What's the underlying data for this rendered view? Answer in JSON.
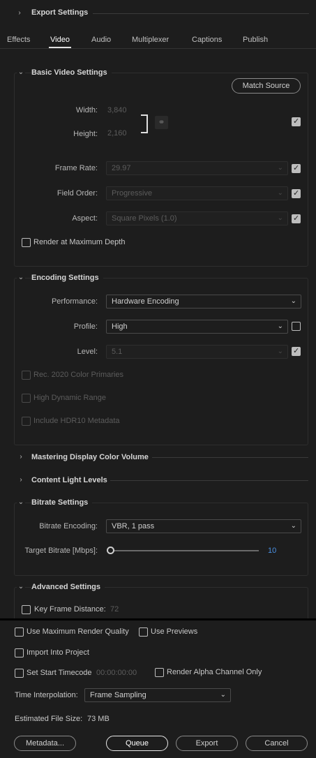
{
  "export_settings": {
    "title": "Export Settings"
  },
  "tabs": [
    {
      "label": "Effects"
    },
    {
      "label": "Video",
      "active": true
    },
    {
      "label": "Audio"
    },
    {
      "label": "Multiplexer"
    },
    {
      "label": "Captions"
    },
    {
      "label": "Publish"
    }
  ],
  "basic_video": {
    "title": "Basic Video Settings",
    "match_source": "Match Source",
    "width_label": "Width:",
    "width_value": "3,840",
    "height_label": "Height:",
    "height_value": "2,160",
    "frame_rate_label": "Frame Rate:",
    "frame_rate_value": "29.97",
    "field_order_label": "Field Order:",
    "field_order_value": "Progressive",
    "aspect_label": "Aspect:",
    "aspect_value": "Square Pixels (1.0)",
    "render_max_depth": "Render at Maximum Depth"
  },
  "encoding": {
    "title": "Encoding Settings",
    "performance_label": "Performance:",
    "performance_value": "Hardware Encoding",
    "profile_label": "Profile:",
    "profile_value": "High",
    "level_label": "Level:",
    "level_value": "5.1",
    "rec2020": "Rec. 2020 Color Primaries",
    "hdr": "High Dynamic Range",
    "hdr10": "Include HDR10 Metadata"
  },
  "mastering": {
    "title": "Mastering Display Color Volume"
  },
  "content_light": {
    "title": "Content Light Levels"
  },
  "bitrate": {
    "title": "Bitrate Settings",
    "encoding_label": "Bitrate Encoding:",
    "encoding_value": "VBR, 1 pass",
    "target_label": "Target Bitrate [Mbps]:",
    "target_value": "10",
    "target_fraction": 0
  },
  "advanced": {
    "title": "Advanced Settings",
    "key_frame_label": "Key Frame Distance:",
    "key_frame_value": "72"
  },
  "bottom": {
    "max_render_quality": "Use Maximum Render Quality",
    "use_previews": "Use Previews",
    "import_into_project": "Import Into Project",
    "set_start_timecode": "Set Start Timecode",
    "timecode_value": "00:00:00:00",
    "render_alpha": "Render Alpha Channel Only",
    "time_interp_label": "Time Interpolation:",
    "time_interp_value": "Frame Sampling",
    "est_file_size_label": "Estimated File Size:",
    "est_file_size_value": "73 MB",
    "metadata": "Metadata...",
    "queue": "Queue",
    "export": "Export",
    "cancel": "Cancel"
  },
  "colors": {
    "background": "#1d1d1d",
    "accent_value": "#4a90e2"
  }
}
